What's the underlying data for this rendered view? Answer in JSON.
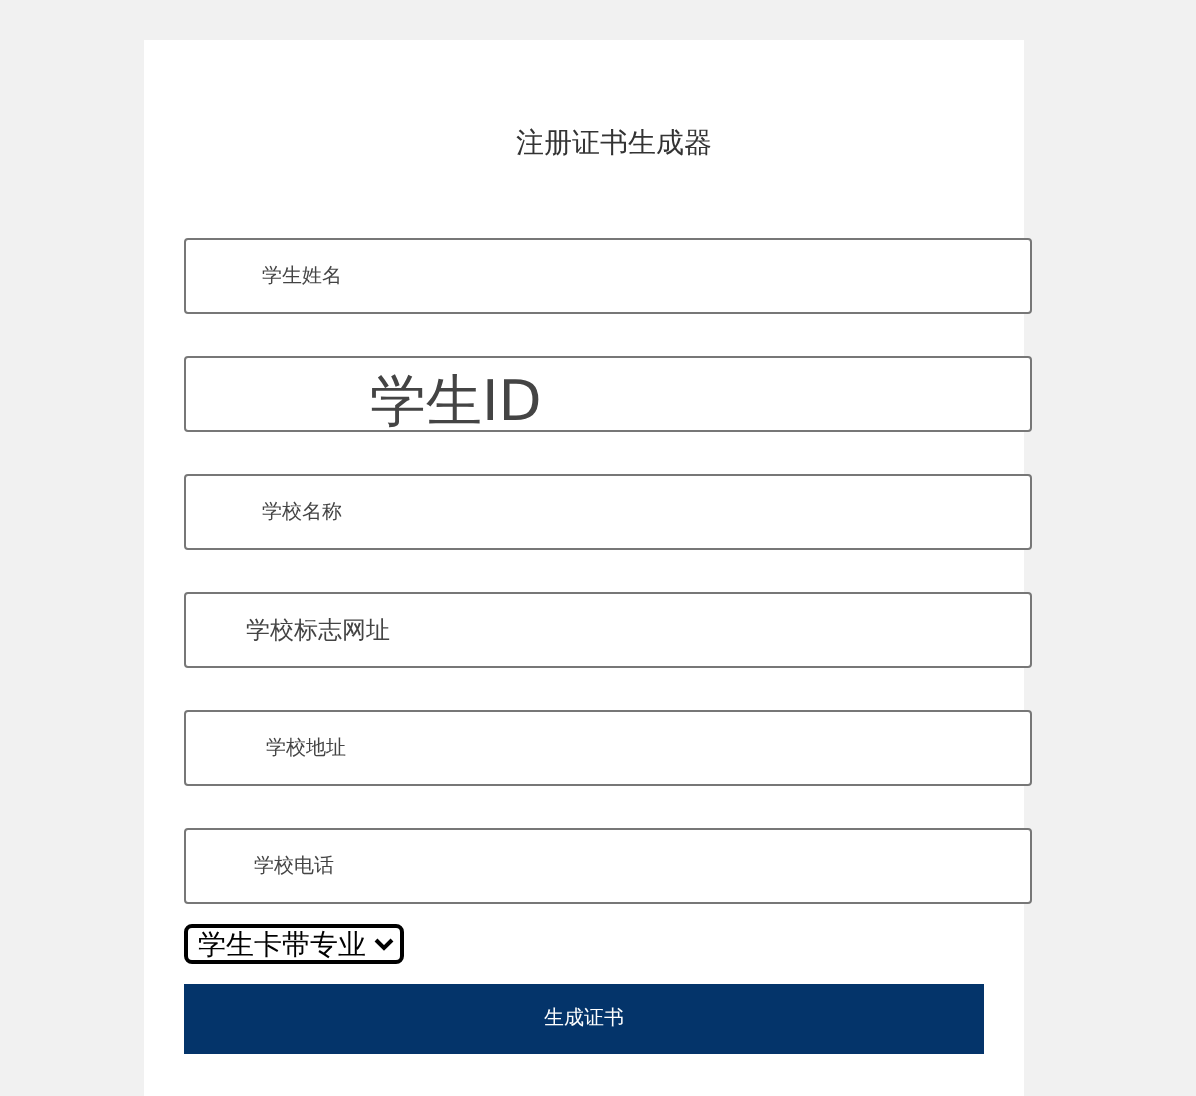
{
  "title": "注册证书生成器",
  "fields": [
    {
      "placeholder": "学生姓名"
    },
    {
      "placeholder": "学生ID"
    },
    {
      "placeholder": "学校名称"
    },
    {
      "placeholder": "学校标志网址"
    },
    {
      "placeholder": "学校地址"
    },
    {
      "placeholder": "学校电话"
    }
  ],
  "select": {
    "value": "学生卡带专业"
  },
  "button": "生成证书"
}
